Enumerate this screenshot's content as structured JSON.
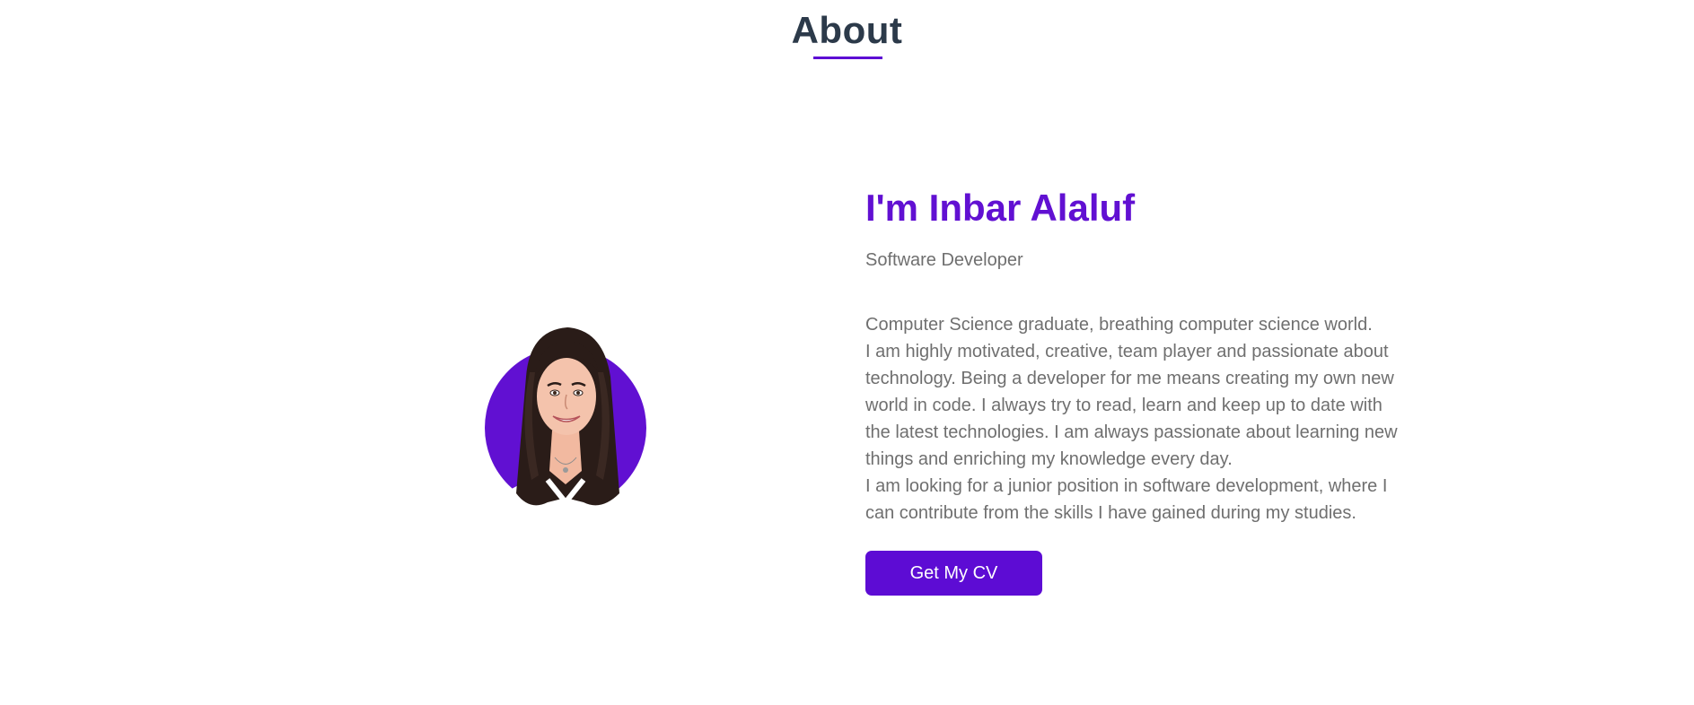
{
  "section": {
    "title": "About"
  },
  "profile": {
    "heading": "I'm Inbar Alaluf",
    "role": "Software Developer",
    "bio": [
      "Computer Science graduate, breathing computer science world.",
      "I am highly motivated, creative, team player and passionate about technology. Being a developer for me means creating my own new world in code. I always try to read, learn and keep up to date with the latest technologies. I am always passionate about learning new things and enriching my knowledge every day.",
      "I am looking for a junior position in software development, where I can contribute from the skills I have gained during my studies."
    ],
    "cv_button_label": "Get My CV",
    "avatar_icon": "cartoon-portrait"
  },
  "colors": {
    "accent": "#5d0cd4",
    "heading": "#2c3a4a",
    "text": "#6f6f6f"
  }
}
